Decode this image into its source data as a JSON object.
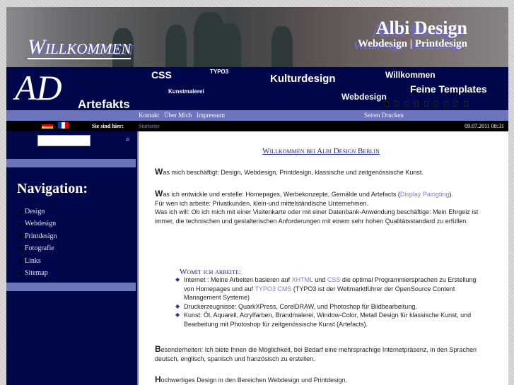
{
  "header": {
    "welcome": "Willkommen",
    "brand_title": "Albi Design",
    "brand_subtitle": "Webdesign | Printdesign"
  },
  "band": {
    "logo": "AD",
    "artefakts": "Artefakts",
    "tags": [
      "CSS",
      "TYPO3",
      "Kunstmalerei",
      "Kulturdesign",
      "Webdesign",
      "Willkommen",
      "Feine Templates"
    ]
  },
  "menu": {
    "items": [
      "Kontakt",
      "Über Mich",
      "Impressum"
    ],
    "print": "Seiten Drucken"
  },
  "breadcrumb": {
    "label": "Sie sind hier:",
    "current": "Startseite",
    "datetime": "09.07.2011 08:31"
  },
  "sidebar": {
    "search_placeholder": "",
    "heading": "Navigation:",
    "items": [
      "Design",
      "Webdesign",
      "Printdesign",
      "Fotografie",
      "Links",
      "Sitemap"
    ]
  },
  "content": {
    "title": "Willkommen bei Albi Design Berlin",
    "p1_initial": "W",
    "p1": "as mich beschäftigt: Design, Webdesign, Printdesign, klassische und zeitgenössische Kunst.",
    "p2_initial": "W",
    "p2": "as ich entwickle und erstelle: Homepages, Werbekonzepte, Gemälde und Artefacts (",
    "p2_link": "Display Paingting",
    "p2_end": ").",
    "p3": "Für wen ich arbeite: Privatkunden, klein-und mittelständische Unternehmen.",
    "p4": "Was ich will: Ob ich mich mit einer Visitenkarte oder mit einer Datenbank-Anwendung beschäftige: Mein Ehrgeiz ist immer, die technischen und gestalterischen Anforderungen mit einem sehr hohen Qualitätsstandard zu erfüllen.",
    "subtitle": "Womit ich arbeite:",
    "li1a": "Internet : Meine Arbeiten basieren auf ",
    "xhtml": "XHTML",
    "li1b": " und ",
    "css": "CSS",
    "li1c": " die optimal Programmiersprachen zu Erstellung von Homepages und auf ",
    "typo3": "TYPO3 CMS",
    "li1d": " (TYPO3 ist der Weltmarktführer der OpenSource Content Management Systeme)",
    "li2": "Druckerzeugnisse: QuarkXPress, CorelDRAW, und Photoshop für Bildbearbeitung.",
    "li3": "Kunst: Öl, Aquarell, Acrylfarben, Brandmalerei, Window-Color, Metall Design für klassische Kunst, und Bearbeitung mit Photoshop für zeitgenössische Kunst (Artefacts).",
    "p5_initial": "B",
    "p5": "esonderheiten: Ich biete Ihnen die Möglichkeit, bei Bedarf eine mehrsprachige Internetpräsenz, in den Sprachen deutsch, englisch, spanisch und französisch zu erstellen.",
    "p6_initial": "H",
    "p6": "ochwertiges Design in den Bereichen Webdesign und Printdesign."
  }
}
